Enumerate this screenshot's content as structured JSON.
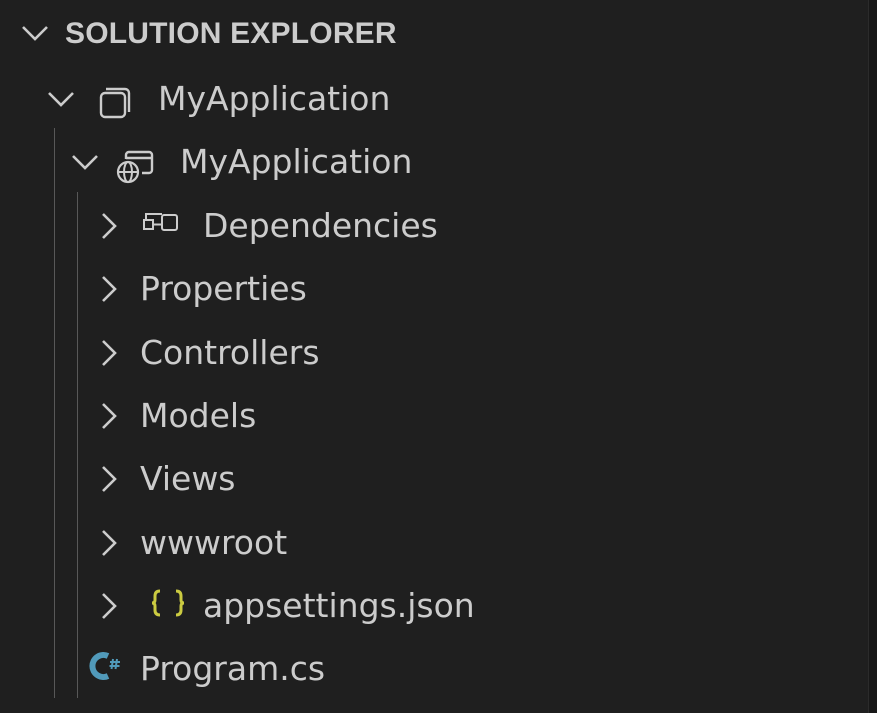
{
  "panel": {
    "title": "SOLUTION EXPLORER"
  },
  "tree": {
    "solution": {
      "label": "MyApplication",
      "expanded": true,
      "icon": "solution-icon"
    },
    "project": {
      "label": "MyApplication",
      "expanded": true,
      "icon": "web-project-icon"
    },
    "items": [
      {
        "label": "Dependencies",
        "expandable": true,
        "icon": "dependencies-icon"
      },
      {
        "label": "Properties",
        "expandable": true,
        "icon": ""
      },
      {
        "label": "Controllers",
        "expandable": true,
        "icon": ""
      },
      {
        "label": "Models",
        "expandable": true,
        "icon": ""
      },
      {
        "label": "Views",
        "expandable": true,
        "icon": ""
      },
      {
        "label": "wwwroot",
        "expandable": true,
        "icon": ""
      },
      {
        "label": "appsettings.json",
        "expandable": true,
        "icon": "json-braces-icon"
      },
      {
        "label": "Program.cs",
        "expandable": false,
        "icon": "csharp-file-icon"
      }
    ]
  },
  "colors": {
    "background": "#1f1f1f",
    "text": "#cccccc",
    "guide": "#585858",
    "json_icon": "#cbcb41",
    "csharp_icon": "#519aba"
  }
}
